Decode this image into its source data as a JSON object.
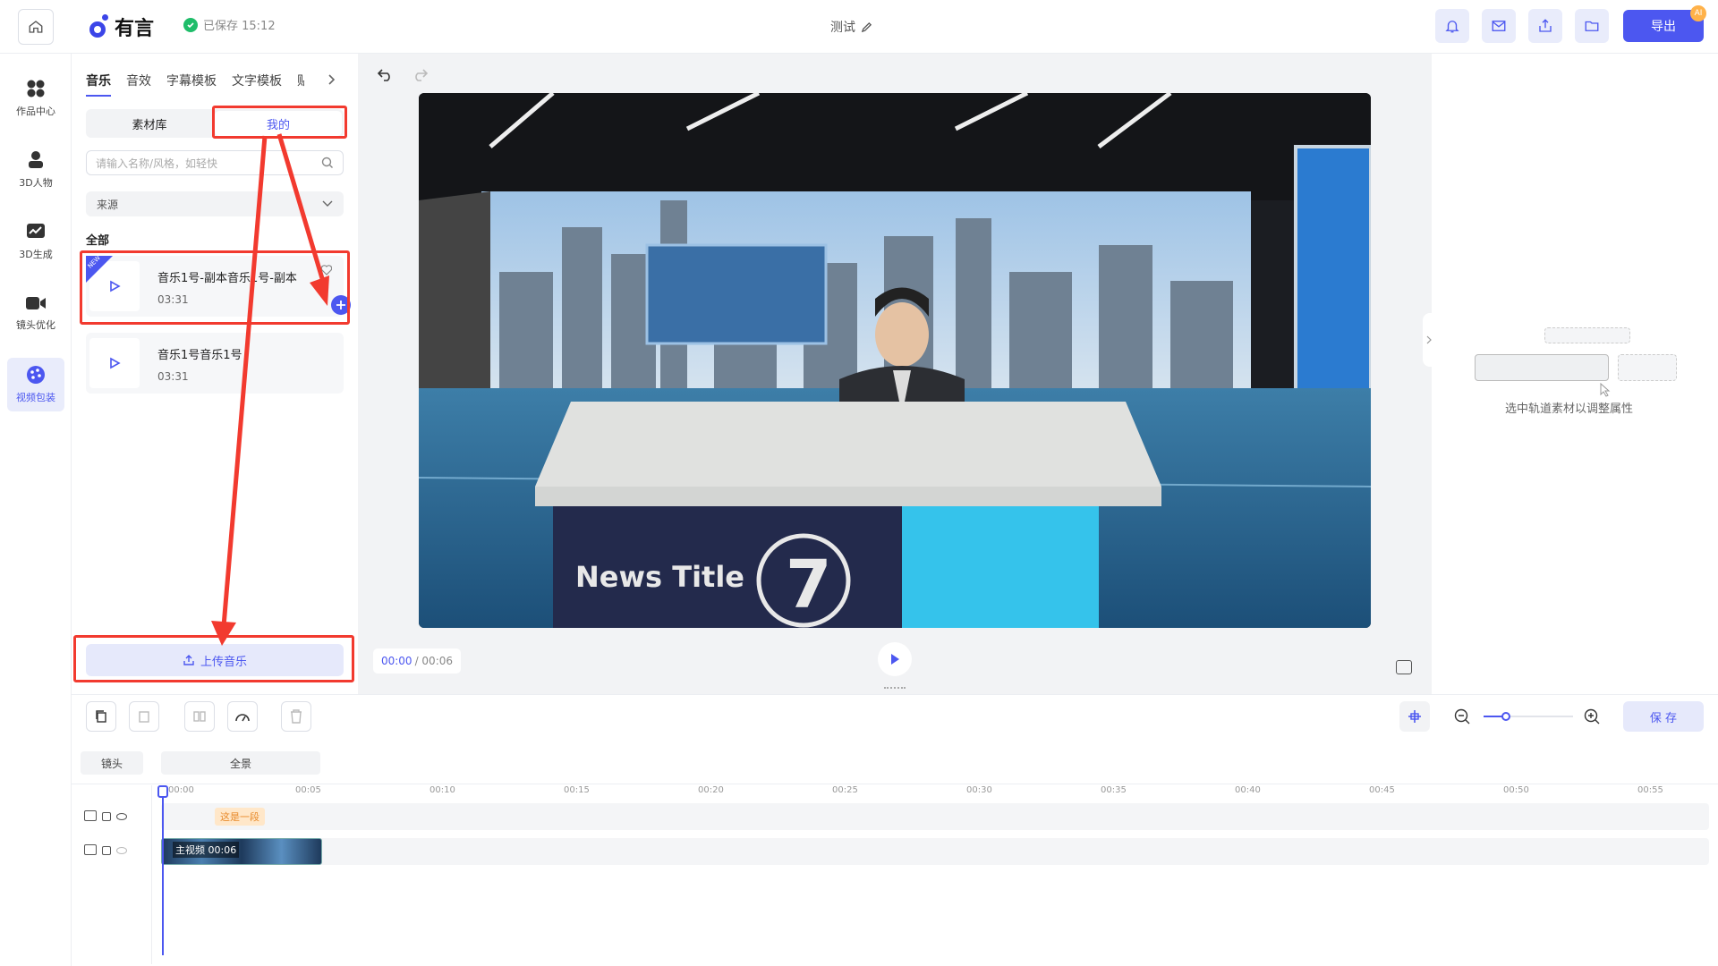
{
  "app": {
    "brand": "有言",
    "saved_status": "已保存 15:12",
    "doc_title": "测试",
    "export_label": "导出",
    "ai_badge": "AI"
  },
  "rail": [
    {
      "label": "作品中心",
      "icon": "grid-icon"
    },
    {
      "label": "3D人物",
      "icon": "avatar-icon"
    },
    {
      "label": "3D生成",
      "icon": "chart-icon"
    },
    {
      "label": "镜头优化",
      "icon": "camera-icon"
    },
    {
      "label": "视频包装",
      "icon": "palette-icon"
    }
  ],
  "panel": {
    "tabs": [
      "音乐",
      "音效",
      "字幕模板",
      "文字模板",
      "贴"
    ],
    "segments": [
      "素材库",
      "我的"
    ],
    "search_placeholder": "请输入名称/风格，如轻快",
    "source_select": "来源",
    "section_title": "全部",
    "cards": [
      {
        "name": "音乐1号-副本音乐1号-副本",
        "duration": "03:31",
        "new": "NEW"
      },
      {
        "name": "音乐1号音乐1号",
        "duration": "03:31"
      }
    ],
    "upload_label": "上传音乐"
  },
  "preview": {
    "time_current": "00:00",
    "time_total": "/ 00:06",
    "overlay_title": "News Title",
    "overlay_number": "7"
  },
  "props": {
    "empty_hint": "选中轨道素材以调整属性"
  },
  "timeline": {
    "save_label": "保 存",
    "chip_camera": "镜头",
    "chip_scene": "全景",
    "ticks": [
      "00:00",
      "00:05",
      "00:10",
      "00:15",
      "00:20",
      "00:25",
      "00:30",
      "00:35",
      "00:40",
      "00:45",
      "00:50",
      "00:55"
    ],
    "subtitle_clip": "这是一段",
    "video_clip": "主视频 00:06"
  }
}
